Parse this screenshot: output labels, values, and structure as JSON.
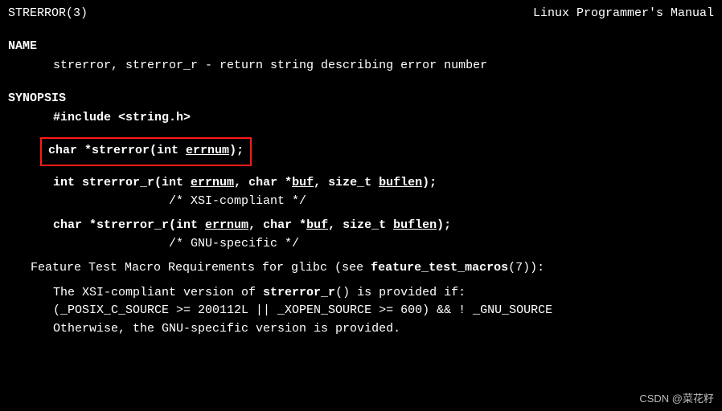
{
  "header": {
    "left": "STRERROR(3)",
    "right": "Linux Programmer's Manual"
  },
  "name_section": {
    "heading": "NAME",
    "line": "strerror, strerror_r - return string describing error number"
  },
  "synopsis": {
    "heading": "SYNOPSIS",
    "include_pre": "#include <",
    "include_hdr": "string.h",
    "include_post": ">",
    "fn1": {
      "pre": "char *",
      "name": "strerror",
      "open": "(int ",
      "arg1": "errnum",
      "close": ");"
    },
    "fn2": {
      "pre": "int ",
      "name": "strerror_r",
      "open": "(int ",
      "arg1": "errnum",
      "mid1": ", char *",
      "arg2": "buf",
      "mid2": ", size_t ",
      "arg3": "buflen",
      "close": ");",
      "comment": "/* XSI-compliant */"
    },
    "fn3": {
      "pre": "char *",
      "name": "strerror_r",
      "open": "(int ",
      "arg1": "errnum",
      "mid1": ", char *",
      "arg2": "buf",
      "mid2": ", size_t ",
      "arg3": "buflen",
      "close": ");",
      "comment": "/* GNU-specific */"
    }
  },
  "ftm": {
    "line1_pre": "Feature Test Macro Requirements for glibc (see ",
    "line1_bold": "feature_test_macros",
    "line1_post": "(7)):",
    "line2_pre": "The XSI-compliant version of ",
    "line2_bold": "strerror_r",
    "line2_post": "() is provided if:",
    "line3": "(_POSIX_C_SOURCE >= 200112L || _XOPEN_SOURCE >= 600) && ! _GNU_SOURCE",
    "line4": "Otherwise, the GNU-specific version is provided."
  },
  "watermark": "CSDN @菜花籽"
}
